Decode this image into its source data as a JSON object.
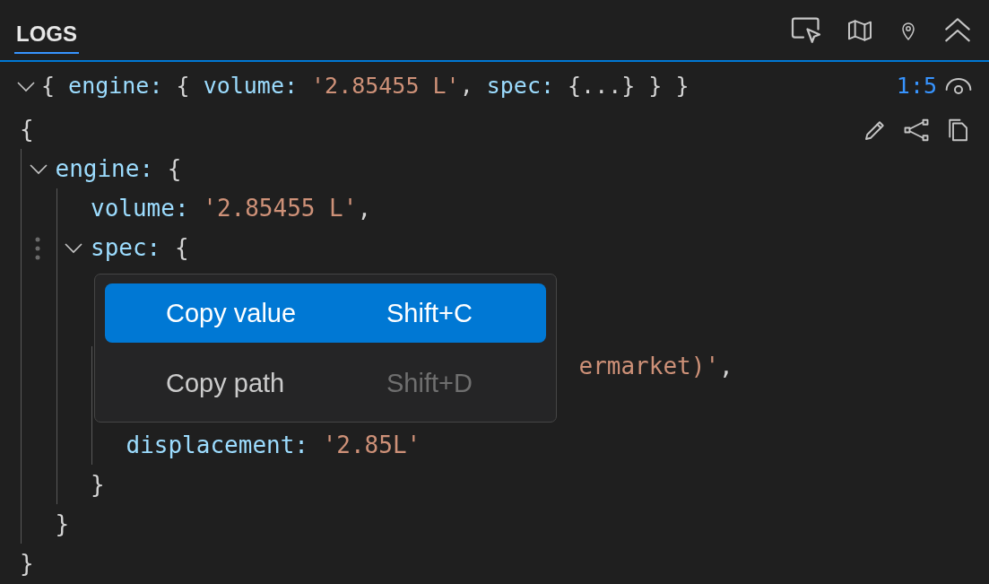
{
  "panel": {
    "tabs": [
      {
        "label": "LOGS",
        "selected": true
      }
    ]
  },
  "summary": {
    "expanded": true,
    "position": "1:5",
    "segments": [
      {
        "kind": "punct",
        "text": "{ "
      },
      {
        "kind": "key",
        "text": "engine: "
      },
      {
        "kind": "punct",
        "text": "{ "
      },
      {
        "kind": "key",
        "text": "volume: "
      },
      {
        "kind": "string",
        "text": "'2.85455 L'"
      },
      {
        "kind": "punct",
        "text": ", "
      },
      {
        "kind": "key",
        "text": "spec: "
      },
      {
        "kind": "punct",
        "text": "{...} } }"
      }
    ]
  },
  "tree": {
    "open": "{",
    "close": "}",
    "children": [
      {
        "kind": "entry",
        "key": "engine:",
        "open": "{",
        "close": "}",
        "expanded": true,
        "hovered": false,
        "children": [
          {
            "kind": "entry",
            "key": "volume:",
            "value": "'2.85455 L'",
            "trail": ","
          },
          {
            "kind": "entry",
            "key": "spec:",
            "open": "{",
            "close": "}",
            "expanded": true,
            "hovered": true,
            "children": [
              {
                "kind": "partial",
                "value": "ermarket)'",
                "trail": ","
              },
              {
                "kind": "entry",
                "key": "displacement:",
                "value": "'2.85L'"
              }
            ]
          }
        ]
      }
    ]
  },
  "context_menu": {
    "items": [
      {
        "label": "Copy value",
        "shortcut": "Shift+C",
        "selected": true
      },
      {
        "label": "Copy path",
        "shortcut": "Shift+D",
        "selected": false
      }
    ]
  }
}
